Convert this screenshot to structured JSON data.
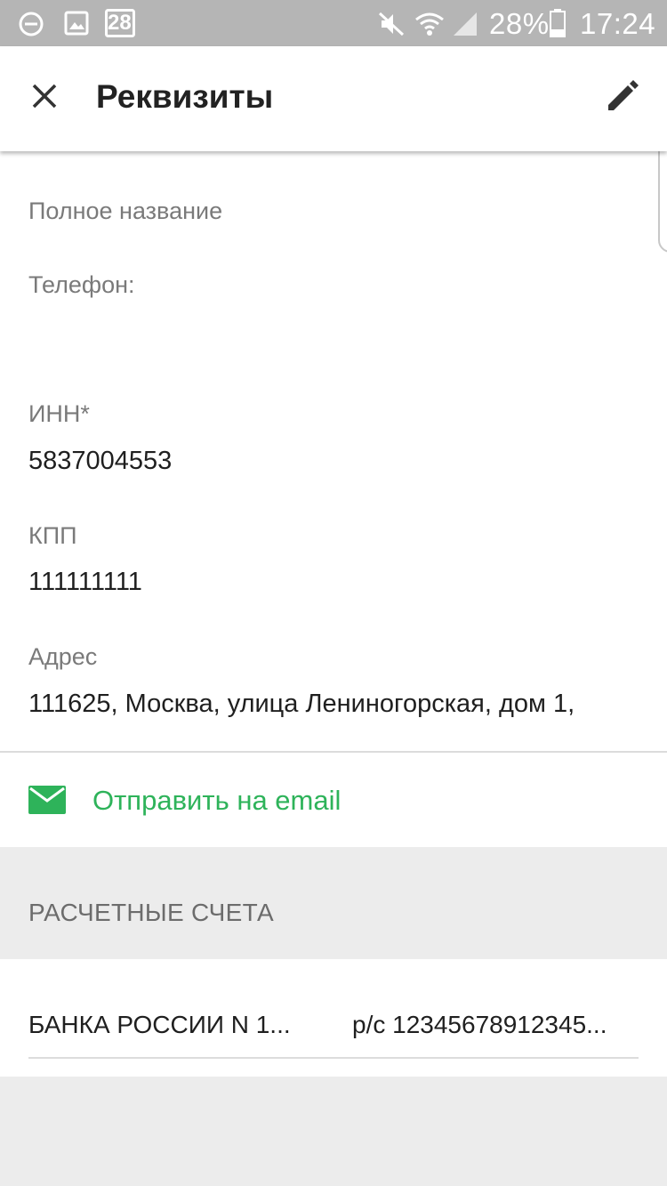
{
  "status_bar": {
    "notification_count": "28",
    "battery_percent": "28%",
    "time": "17:24",
    "icons": [
      "minus-circle-icon",
      "image-icon",
      "calendar-icon",
      "mute-icon",
      "wifi-icon",
      "signal-icon",
      "battery-icon"
    ]
  },
  "app_bar": {
    "title": "Реквизиты",
    "close_icon": "close-icon",
    "edit_icon": "pencil-icon"
  },
  "details": {
    "full_name_label": "Полное название",
    "phone_label": "Телефон:",
    "inn_label": "ИНН*",
    "inn_value": "5837004553",
    "kpp_label": "КПП",
    "kpp_value": "111111111",
    "address_label": "Адрес",
    "address_value": "111625, Москва, улица Лениногорская, дом  1,"
  },
  "email_action": {
    "label": "Отправить на email",
    "icon": "mail-icon",
    "color": "#2eb35a"
  },
  "accounts_section": {
    "header": "РАСЧЕТНЫЕ СЧЕТА",
    "items": [
      {
        "bank": "БАНКА РОССИИ N 1...",
        "account": "р/с 12345678912345..."
      }
    ]
  }
}
